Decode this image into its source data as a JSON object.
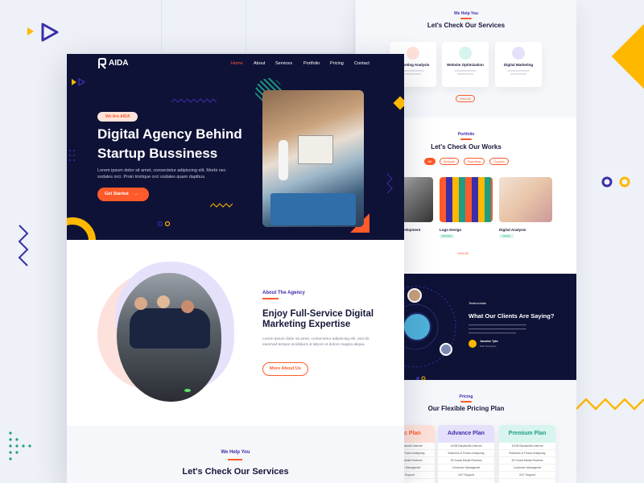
{
  "back": {
    "services": {
      "kicker": "We Help You",
      "title": "Let's Check Our Services",
      "cards": [
        {
          "title": "Marketing Analysis",
          "icon": "chart-icon"
        },
        {
          "title": "Website Optimization",
          "icon": "optimize-icon"
        },
        {
          "title": "Digital Marketing",
          "icon": "megaphone-icon"
        }
      ],
      "view_all": "View All"
    },
    "portfolio": {
      "kicker": "Portfolio",
      "title": "Let's Check Our Works",
      "filters": [
        "All",
        "Website",
        "Branding",
        "Graphic"
      ],
      "items": [
        {
          "title": "Development",
          "tag": ""
        },
        {
          "title": "Logo Design",
          "tag": "Branding"
        },
        {
          "title": "Digital Analysis",
          "tag": "Design"
        }
      ],
      "view_all": "View All"
    },
    "testimonials": {
      "kicker": "Testimonials",
      "title": "What Our Clients Are Saying?",
      "author": "Jasmine Tyke",
      "role": "Web Developer"
    },
    "pricing": {
      "kicker": "Pricing",
      "title": "Our Flexible Pricing Plan",
      "plans": [
        {
          "name": "Basic Plan",
          "color": "#ff5a2b",
          "bg": "#ffe3da"
        },
        {
          "name": "Advance Plan",
          "color": "#3b2ea8",
          "bg": "#e6e1fb"
        },
        {
          "name": "Premium Plan",
          "color": "#1f9d84",
          "bg": "#d8f4ee"
        }
      ],
      "features": [
        "10GB Bandwidth Internet",
        "Business & Financ Analysing",
        "25 Social Media Reviews",
        "Customer Managemet",
        "24/7 Support"
      ]
    }
  },
  "front": {
    "logo": "AIDA",
    "nav": [
      "Home",
      "About",
      "Services",
      "Portfolio",
      "Pricing",
      "Contact"
    ],
    "hero": {
      "badge": "We Are AIDA",
      "title_line1": "Digital Agency Behind",
      "title_line2": "Startup Bussiness",
      "body": "Lorem ipsum dolor sit amet, consectetur adipiscing elit. Morbi nec sodales orci. Proin tristique orci sodales quam dapibus.",
      "cta": "Get Started"
    },
    "about": {
      "kicker": "About The Agency",
      "title_line1": "Enjoy Full-Service Digital",
      "title_line2": "Marketing Expertise",
      "body": "Lorem ipsum dolor sit amet, consectetur adipiscing elit, sed do eiusmod tempor incididunt ut labore et dolore magna aliqua.",
      "cta": "More About Us"
    },
    "services": {
      "kicker": "We Help You",
      "title": "Let's Check Our Services"
    }
  },
  "colors": {
    "navy": "#0f1237",
    "orange": "#ff5a2b",
    "yellow": "#ffb800",
    "purple": "#3b2ea8",
    "teal": "#1f9d84"
  }
}
